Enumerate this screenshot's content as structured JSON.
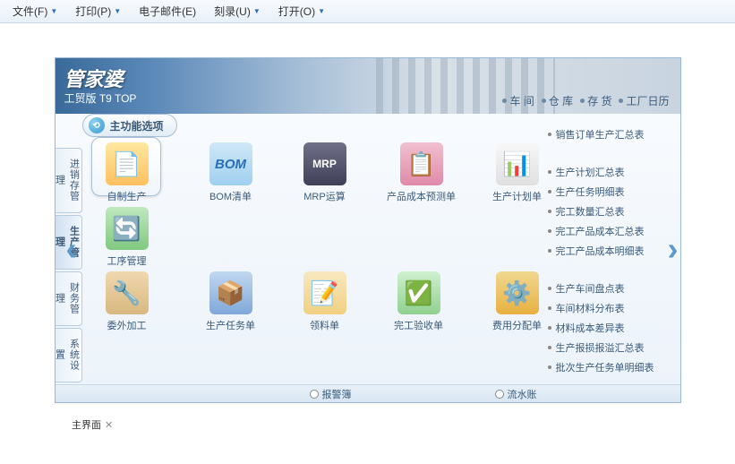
{
  "topmenu": {
    "file": "文件(F)",
    "print": "打印(P)",
    "email": "电子邮件(E)",
    "burn": "刻录(U)",
    "open": "打开(O)"
  },
  "header": {
    "logo_main": "管家婆",
    "logo_sub": "工贸版 T9 TOP",
    "nav": {
      "workshop": "车 间",
      "warehouse": "仓 库",
      "inventory": "存 货",
      "calendar": "工厂日历"
    }
  },
  "sidebar": {
    "tab1": "进销存管理",
    "tab2": "生产管理",
    "tab3": "财务管理",
    "tab4": "系统设置",
    "main_tab": "主功能选项"
  },
  "grid": {
    "r0c0": "自制生产",
    "r0c1": "BOM清单",
    "r0c1_icon": "BOM",
    "r0c2": "MRP运算",
    "r0c2_icon": "MRP",
    "r0c3": "产品成本预测单",
    "r0c4": "生产计划单",
    "r1c0": "工序管理",
    "r2c0": "委外加工",
    "r2c1": "生产任务单",
    "r2c2": "领料单",
    "r2c3": "完工验收单",
    "r2c4": "费用分配单"
  },
  "right": {
    "g1_1": "销售订单生产汇总表",
    "g2_1": "生产计划汇总表",
    "g2_2": "生产任务明细表",
    "g2_3": "完工数量汇总表",
    "g2_4": "完工产品成本汇总表",
    "g2_5": "完工产品成本明细表",
    "g3_1": "生产车间盘点表",
    "g3_2": "车间材料分布表",
    "g3_3": "材料成本差异表",
    "g3_4": "生产报损报溢汇总表",
    "g3_5": "批次生产任务单明细表"
  },
  "footer": {
    "alarm": "报警簿",
    "flow": "流水账"
  },
  "status": {
    "main": "主界面"
  },
  "arrows": {
    "left": "‹",
    "right": "›"
  }
}
